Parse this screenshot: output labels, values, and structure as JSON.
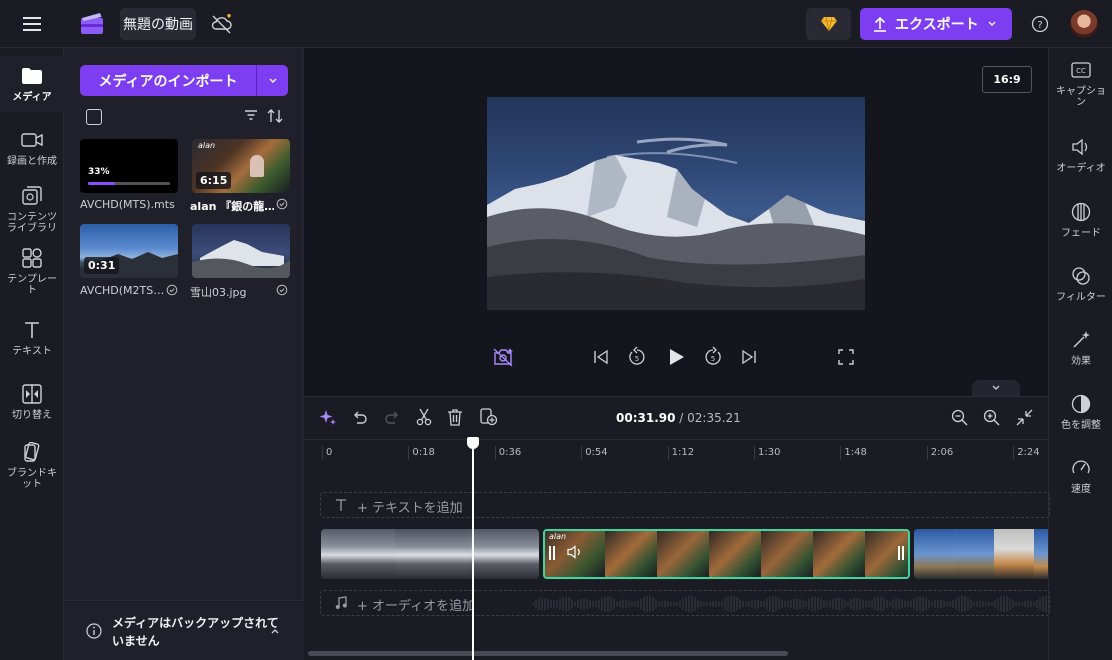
{
  "topbar": {
    "title": "無題の動画",
    "export_label": "エクスポート"
  },
  "left_rail": [
    {
      "label": "メディア",
      "icon": "folder-icon"
    },
    {
      "label": "録画と作成",
      "icon": "camera-icon"
    },
    {
      "label": "コンテンツライブラリ",
      "icon": "library-icon"
    },
    {
      "label": "テンプレート",
      "icon": "template-icon"
    },
    {
      "label": "テキスト",
      "icon": "text-icon"
    },
    {
      "label": "切り替え",
      "icon": "transition-icon"
    },
    {
      "label": "ブランドキット",
      "icon": "brand-kit-icon"
    }
  ],
  "media": {
    "import_label": "メディアのインポート",
    "items": [
      {
        "caption": "AVCHD(MTS).mts",
        "progress_text": "33%",
        "progress": 0.33
      },
      {
        "caption": "alan 『銀の龍…",
        "duration": "6:15",
        "thumb_text": "alan"
      },
      {
        "caption": "AVCHD(M2TS…",
        "duration": "0:31"
      },
      {
        "caption": "雪山03.jpg"
      }
    ],
    "backup_text": "メディアはバックアップされていません"
  },
  "preview": {
    "aspect_ratio": "16:9"
  },
  "right_rail": [
    {
      "label": "キャプション",
      "icon": "cc-icon"
    },
    {
      "label": "オーディオ",
      "icon": "speaker-icon"
    },
    {
      "label": "フェード",
      "icon": "fade-icon"
    },
    {
      "label": "フィルター",
      "icon": "filter-icon"
    },
    {
      "label": "効果",
      "icon": "magic-wand-icon"
    },
    {
      "label": "色を調整",
      "icon": "contrast-icon"
    },
    {
      "label": "速度",
      "icon": "speedometer-icon"
    }
  ],
  "timeline": {
    "current_time": "00:31.90",
    "total_time": "/ 02:35.21",
    "ticks": [
      "0",
      "0:18",
      "0:36",
      "0:54",
      "1:12",
      "1:30",
      "1:48",
      "2:06",
      "2:24"
    ],
    "text_track_label": "+ テキストを追加",
    "audio_track_label": "+ オーディオを追加",
    "clip_text": "alan"
  },
  "colors": {
    "accent": "#7d3ef1",
    "selected_clip_border": "#3dd6a0"
  }
}
